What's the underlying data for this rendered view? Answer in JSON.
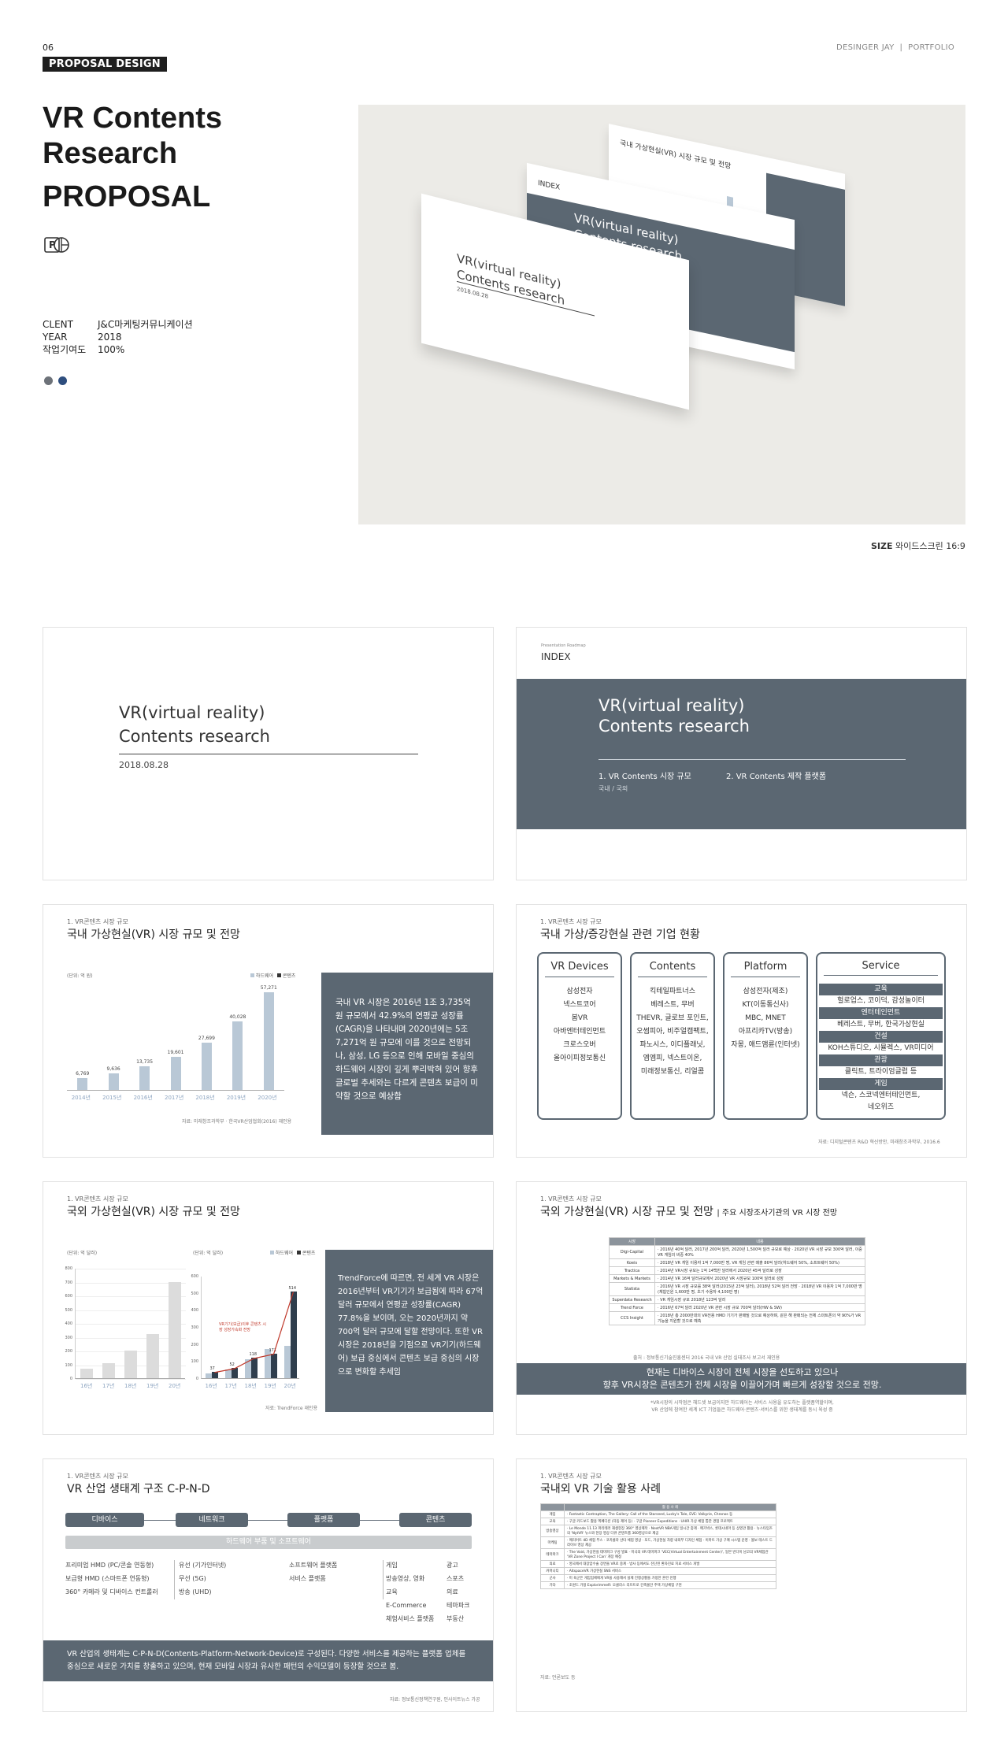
{
  "header": {
    "page_number": "06",
    "category_badge": "PROPOSAL DESIGN",
    "designer": "DESINGER JAY  |  PORTFOLIO"
  },
  "project": {
    "title_lines": [
      "VR Contents",
      "Research",
      "PROPOSAL"
    ],
    "app_icon_letter": "P",
    "info": [
      {
        "label": "CLENT",
        "value": "J&C마케팅커뮤니케이션"
      },
      {
        "label": "YEAR",
        "value": "2018"
      },
      {
        "label": "작업기여도",
        "value": "100%"
      }
    ],
    "dot_colors": [
      "#6d7279",
      "#2e4e7e"
    ]
  },
  "mockup": {
    "front_title_1": "VR(virtual reality)",
    "front_title_2": "Contents research",
    "front_date": "2018.08.28",
    "mid_label": "INDEX",
    "back_title": "국내 가상현실(VR) 시장 규모 및 전망"
  },
  "size_note": {
    "bold": "SIZE",
    "text": "와이드스크린 16:9"
  },
  "slide1": {
    "title1": "VR(virtual reality)",
    "title2": "Contents research",
    "date": "2018.08.28"
  },
  "slide2": {
    "tiny": "Presentation  Roadmap",
    "index": "INDEX",
    "title1": "VR(virtual reality)",
    "title2": "Contents research",
    "item1": "1. VR Contents 시장 규모",
    "item2": "2. VR Contents 제작 플랫폼",
    "item1_sub": "국내 / 국외"
  },
  "slide3": {
    "section": "1. VR콘텐츠 시장 규모",
    "title": "국내 가상현실(VR) 시장 규모 및 전망",
    "unit": "(단위: 억 원)",
    "legend": [
      "하드웨어",
      "콘텐츠"
    ],
    "body": "국내 VR 시장은 2016년 1조 3,735억 원 규모에서 42.9%의 연평균 성장률(CAGR)을 나타내며 2020년에는 5조 7,271억 원 규모에 이를 것으로 전망되나, 삼성, LG 등으로 인해 모바일 중심의 하드웨어 시장이 깊게 뿌리박혀 있어 향후 글로벌 추세와는 다르게 콘텐츠 보급이 미약할 것으로 예상함",
    "source": "자료: 미래창조과학부 · 한국VR산업협회(2016) 재인용"
  },
  "slide4": {
    "section": "1. VR콘텐츠 시장 규모",
    "title": "국내 가상/증강현실 관련 기업 현황",
    "columns": [
      {
        "head": "VR Devices",
        "items": [
          "삼성전자",
          "넥스트코어",
          "봄VR",
          "아바엔터테인먼트",
          "크로스오버",
          "올아이피정보통신"
        ]
      },
      {
        "head": "Contents",
        "items": [
          "킥테일파트너스",
          "베레스트, 무버",
          "THEVR, 글로브 포인트,",
          "오썸피아, 비주얼캠팩트,",
          "파노시스, 이디플래닛,",
          "엠엠피, 넥스트이온,",
          "미래정보통신, 리얼콤"
        ]
      },
      {
        "head": "Platform",
        "items": [
          "삼성전자(제조)",
          "KT(이동통신사)",
          "MBC, MNET",
          "아프리카TV(방송)",
          "자몽, 애드앰륜(인터넷)"
        ]
      }
    ],
    "service": {
      "head": "Service",
      "groups": [
        {
          "name": "교육",
          "items": [
            "헐로업스, 코이덕, 감성놀이터"
          ]
        },
        {
          "name": "엔터테인먼트",
          "items": [
            "베레스트, 무버, 한국가상현실"
          ]
        },
        {
          "name": "건설",
          "items": [
            "KOH스튜디오, 시뮬렉스, VR미디어"
          ]
        },
        {
          "name": "관광",
          "items": [
            "클릭트, 트라이엄글럽 등"
          ]
        },
        {
          "name": "게임",
          "items": [
            "넥슨, 스코넥엔터테인먼트,",
            "네오위즈"
          ]
        }
      ]
    },
    "source": "자료: 디지털콘텐츠 R&D 혁신방안, 미래창조과학부, 2016.6"
  },
  "slide5": {
    "section": "1. VR콘텐츠 시장 규모",
    "title": "국외 가상현실(VR) 시장 규모 및 전망",
    "unit_left": "(단위: 억 달러)",
    "unit_right": "(단위: 억 달러)",
    "legend": [
      "하드웨어",
      "콘텐츠"
    ],
    "annotation": "VR기기(보급)이후 콘텐츠 시장 성장가속화 전망",
    "body": "TrendForce에 따르면, 전 세계 VR 시장은 2016년부터 VR기기가 보급됨에 따라 67억 달러 규모에서 연평균 성장률(CAGR) 77.8%을 보이며, 오는 2020년까지 약 700억 달러 규모에 달할 전망이다. 또한 VR 시장은 2018년을 기점으로 VR기기(하드웨어) 보급 중심에서 콘텐츠 보급 중심의 시장으로 변화할 추세임",
    "source": "자료: TrendForce 재인용"
  },
  "slide6": {
    "section": "1. VR콘텐츠 시장 규모",
    "title": "국외 가상현실(VR) 시장 규모 및 전망",
    "title_extra": "| 주요 시장조사기관의 VR 시장 전망",
    "table_head": [
      "시장",
      "내용"
    ],
    "rows": [
      [
        "Digi-Capital",
        "· 2016년 40억 달러, 2017년 200억 달러, 2020년 1,500억 달러 규모로 예상 · 2020년 VR 시장 규모 300억 달러, 이중 VR 게임의 비중 40%"
      ],
      [
        "Koeis",
        "· 2018년 VR 게임 이용자 1억 7,000만 명, VR 게임 관련 매출 86억 달러(하드웨어 50%, 소프트웨어 50%)"
      ],
      [
        "Tractica",
        "· 2014년 VR시장 규모는 1억 14백만 달러에서 2020년 45억 달러로 성장"
      ],
      [
        "Markets & Markets",
        "· 2014년 VR 16억 달러규모에서 2020년 VR 시장규모 100억 달러로 성장"
      ],
      [
        "Statista",
        "· 2016년 VR 시장 규모를 38억 달러(2015년 23억 달러), 2018년 52억 달러 전망 · 2018년 VR 이용자 1억 7,000만 명(체험인원 1,600만 명, 초기 수용자 4,100만 명)"
      ],
      [
        "Superdata Research",
        "· VR 게임시장 규모 2018년 123억 달러"
      ],
      [
        "Trend Force",
        "· 2016년 67억 달러 2020년 VR 관련 시장 규모 700억 달러(HW & SW)"
      ],
      [
        "CCS Insight",
        "· 2018년 총 2000만대의 VR전용 HMD 기기가 판매될 것으로 예상하며, 같은 해 판매되는 전체 스마트폰의 약 90%가 VR 기능을 지원할 것으로 예측"
      ]
    ],
    "source": "출처 : 정보통신기술진흥센터 2016 국내 VR 산업 실태조사 보고서 재인용",
    "highlight1": "현재는 디바이스 시장이 전체 시장을 선도하고 있으나",
    "highlight2": "향후 VR시장은 콘텐츠가 전체 시장을 이끌어가며 빠르게 성장할 것으로 전망.",
    "note1": "*VR시장의 시작점은 헤드셋 보급이지만 하드웨어는 서비스 사용을 유도하는 플랫폼역할이며,",
    "note2": "VR 산업에 참여한 세계 ICT 기업들은 하드웨어·콘텐츠·서비스를 위한 생태계를 동시 육성 중"
  },
  "slide7": {
    "section": "1. VR콘텐츠 시장 규모",
    "title": "VR 산업 생태계 구조 C-P-N-D",
    "pills": [
      "디바이스",
      "네트워크",
      "플랫폼",
      "콘텐츠"
    ],
    "bar_label": "하드웨어 부품 및 소프트웨어",
    "device_list": [
      "프리미엄 HMD (PC/콘솔 연동형)",
      "보급형 HMD (스마트폰 연동형)",
      "360° 카메라 및 디바이스 컨트롤러"
    ],
    "network_list": [
      "유선 (기가인터넷)",
      "무선 (5G)",
      "방송 (UHD)"
    ],
    "platform_list": [
      "소프트웨어 플랫폼",
      "서비스 플랫폼"
    ],
    "contents_a": [
      "게임",
      "방송영상, 영화",
      "교육",
      "E-Commerce",
      "체험서비스 플랫폼"
    ],
    "contents_b": [
      "광고",
      "스포츠",
      "의료",
      "테마파크",
      "부동산"
    ],
    "summary": "VR 산업의 생태계는 C-P-N-D(Contents-Platform-Network-Device)로 구성된다. 다양한 서비스를 제공하는 플랫폼 업체를 중심으로 새로운 가치를 창출하고 있으며, 현재 모바일 시장과 유사한 패턴의 수익모델이 등장할 것으로 봄.",
    "source": "자료: 정보통신정책연구원, 인사이트뉴스 가공"
  },
  "slide8": {
    "section": "1. VR콘텐츠 시장 규모",
    "title": "국내외 VR 기술 활용 사례",
    "table_head": "활 용 사 례",
    "rows": [
      [
        "게임",
        "· Fantastic Contraption, The Gallery: Call of the Starseed, Lucky's Tale, EVE: Valkyrie, Chronos 등"
      ],
      [
        "교육",
        "· 구글 카드보드 활용 엑페디션 (자동 제어 등) · 구글 Pioneer Expeditions · UHIR 가상 체험 통한 경험 프로젝트"
      ],
      [
        "방송영상",
        "· Le Monde 11.13 파리테러 재생현장 360° 영상제작 · NextVR NBA게임 일시간 중계 · 메가박스, 롯데시네마 등 상영관 활용 · 뉴스타임즈의 'NytVR' 뉴스와 현장 영상 다큐 콘텐츠를 360영상으로 제공"
      ],
      [
        "마케팅",
        "· 메리어트 4D 체험 부스 · 코카콜라 산타 체험 영상 · 포드, 가상현실 차량 내외부 디자인 체험 · 이마트 가상 구매 시스템 운영 · 볼보 테스트 드라이브 영상 제공"
      ],
      [
        "테마파크",
        "· The Void, 가상현실 테마파크 구성 발표 · 미국의 VR 테마파크 'VEC(Virtual Entertainment Center)', 일본 반다이 남코의 VR체험관 'VR Zone Project I Can' 개장 예정"
      ],
      [
        "의료",
        "· 영국에서 대장암수술 장면을 VR로 중계 · 방사 등에서도 진단된 환자진료 치료 서비스 개발"
      ],
      [
        "커머니티",
        "· AltspaceVR 가상현실 SNS 서비스"
      ],
      [
        "군사",
        "· 미 육군은 게임업체에게 VR을 사용해서 실제 전쟁상황을 가정한 훈련 진행"
      ],
      [
        "기타",
        "· 조원드 가정 ExplorimmeR: 오클라스 리프트로 건축물안 주택 가상체험 구현"
      ]
    ],
    "source": "자료: 언론보도 등"
  },
  "charts": {
    "chart_data": [
      {
        "type": "bar",
        "title": "국내 가상현실(VR) 시장 규모 및 전망",
        "ylabel": "(단위: 억 원)",
        "categories": [
          "2014년",
          "2015년",
          "2016년",
          "2017년",
          "2018년",
          "2019년",
          "2020년"
        ],
        "values": [
          6769,
          9636,
          13735,
          19601,
          27699,
          40028,
          57271
        ],
        "value_labels": [
          "6,769",
          "9,636",
          "13,735",
          "19,601",
          "27,699",
          "40,028",
          "57,271"
        ]
      },
      {
        "type": "bar",
        "ylabel": "(단위: 억 달러)",
        "categories": [
          "16년",
          "17년",
          "18년",
          "19년",
          "20년"
        ],
        "ylim": [
          0,
          800
        ],
        "yticks": [
          "0",
          "100",
          "200",
          "300",
          "400",
          "500",
          "600",
          "700",
          "800"
        ],
        "values": [
          67,
          110,
          200,
          320,
          700
        ]
      },
      {
        "type": "bar",
        "ylabel": "(단위: 억 달러)",
        "categories": [
          "16년",
          "17년",
          "18년",
          "19년",
          "20년"
        ],
        "ylim": [
          0,
          600
        ],
        "yticks": [
          "0",
          "100",
          "200",
          "300",
          "400",
          "500",
          "600"
        ],
        "series": [
          {
            "name": "하드웨어",
            "values": [
              30,
              50,
              110,
              170,
              190
            ]
          },
          {
            "name": "콘텐츠",
            "values": [
              38,
              60,
              120,
              145,
              510
            ]
          }
        ],
        "value_labels": [
          "37",
          "52",
          "118",
          "171",
          "514"
        ]
      }
    ]
  }
}
